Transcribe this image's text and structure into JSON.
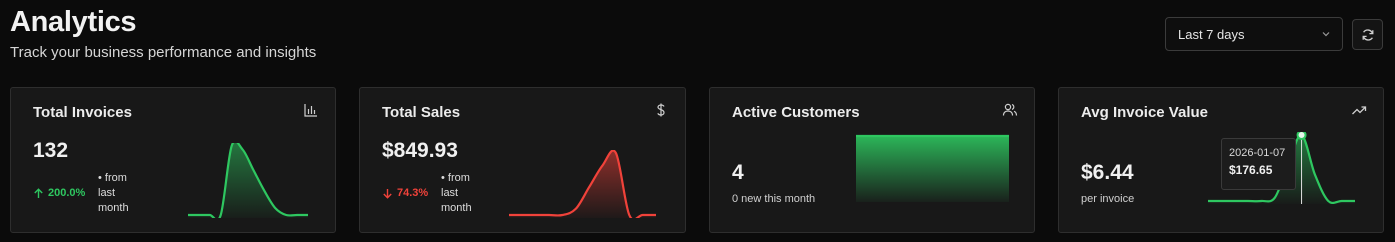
{
  "header": {
    "title": "Analytics",
    "subtitle": "Track your business performance and insights"
  },
  "controls": {
    "range_label": "Last 7 days",
    "chevron_icon": "chevron-down-icon",
    "refresh_icon": "refresh-icon"
  },
  "colors": {
    "positive": "#2ec760",
    "negative": "#f0423a"
  },
  "cards": {
    "invoices": {
      "title": "Total Invoices",
      "icon": "bar-chart-icon",
      "value": "132",
      "change": "200.0%",
      "direction": "up",
      "from_line1": "• from",
      "from_line2": "last",
      "from_line3": "month",
      "sparkline": [
        0,
        0,
        0,
        0,
        1,
        0.95,
        0.65,
        0.35,
        0.1,
        0,
        0,
        0
      ]
    },
    "sales": {
      "title": "Total Sales",
      "icon": "dollar-icon",
      "value": "$849.93",
      "change": "74.3%",
      "direction": "down",
      "from_line1": "• from",
      "from_line2": "last",
      "from_line3": "month",
      "sparkline": [
        0,
        0,
        0,
        0,
        0,
        0.1,
        0.45,
        0.8,
        1,
        0,
        0,
        0
      ]
    },
    "customers": {
      "title": "Active Customers",
      "icon": "users-icon",
      "value": "4",
      "note": "0 new this month",
      "sparkline": [
        1,
        1,
        1,
        1,
        1,
        1,
        1
      ]
    },
    "avg_invoice": {
      "title": "Avg Invoice Value",
      "icon": "trending-up-icon",
      "value": "$6.44",
      "note": "per invoice",
      "sparkline": [
        0,
        0,
        0,
        0,
        0,
        0.05,
        0.55,
        1,
        0.4,
        0,
        0,
        0
      ],
      "tooltip_date": "2026-01-07",
      "tooltip_value": "$176.65"
    }
  }
}
